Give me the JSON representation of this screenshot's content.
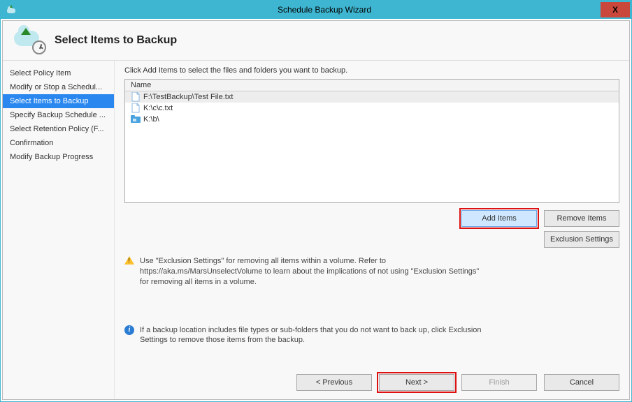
{
  "titlebar": {
    "title": "Schedule Backup Wizard",
    "close": "X"
  },
  "header": {
    "title": "Select Items to Backup"
  },
  "sidebar": {
    "items": [
      {
        "label": "Select Policy Item",
        "selected": false
      },
      {
        "label": "Modify or Stop a Schedul...",
        "selected": false
      },
      {
        "label": "Select Items to Backup",
        "selected": true
      },
      {
        "label": "Specify Backup Schedule ...",
        "selected": false
      },
      {
        "label": "Select Retention Policy (F...",
        "selected": false
      },
      {
        "label": "Confirmation",
        "selected": false
      },
      {
        "label": "Modify Backup Progress",
        "selected": false
      }
    ]
  },
  "main": {
    "instruction": "Click Add Items to select the files and folders you want to backup.",
    "list": {
      "header": "Name",
      "rows": [
        {
          "label": "F:\\TestBackup\\Test File.txt",
          "icon": "file-icon",
          "selected": true
        },
        {
          "label": "K:\\c\\c.txt",
          "icon": "file-icon",
          "selected": false
        },
        {
          "label": "K:\\b\\",
          "icon": "folder-icon",
          "selected": false
        }
      ]
    },
    "buttons": {
      "add": "Add Items",
      "remove": "Remove Items",
      "exclusion": "Exclusion Settings"
    },
    "warning": "Use \"Exclusion Settings\" for removing all items within a volume. Refer to https://aka.ms/MarsUnselectVolume to learn about the implications of not using \"Exclusion Settings\" for removing all items in a volume.",
    "info": "If a backup location includes file types or sub-folders that you do not want to back up, click Exclusion Settings to remove those items from the backup."
  },
  "footer": {
    "previous": "< Previous",
    "next": "Next >",
    "finish": "Finish",
    "cancel": "Cancel"
  }
}
